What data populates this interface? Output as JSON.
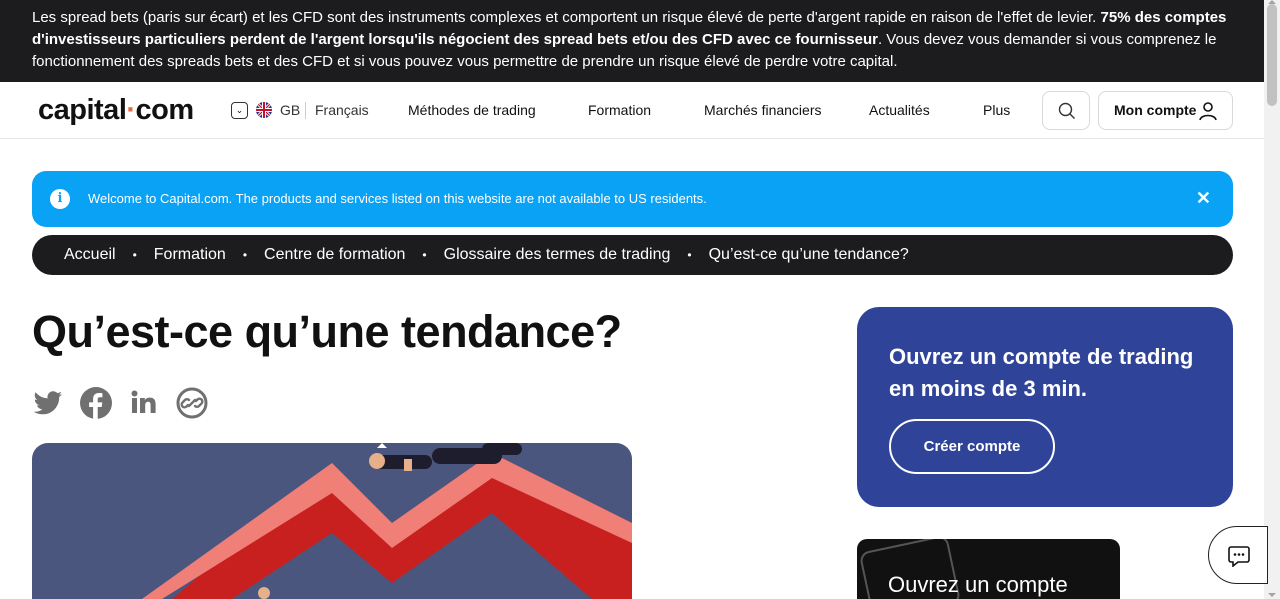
{
  "risk_banner": {
    "text_start": "Les spread bets (paris sur écart) et les CFD sont des instruments complexes et comportent un risque élevé de perte d'argent rapide en raison de l'effet de levier. ",
    "text_bold": "75% des comptes d'investisseurs particuliers perdent de l'argent lorsqu'ils négocient des spread bets et/ou des CFD avec ce fournisseur",
    "text_end": ". Vous devez vous demander si vous comprenez le fonctionnement des spreads bets et des CFD et si vous pouvez vous permettre de prendre un risque élevé de perdre votre capital."
  },
  "header": {
    "logo_left": "capital",
    "logo_dot": "·",
    "logo_right": "com",
    "region_code": "GB",
    "language": "Français",
    "nav": [
      "Méthodes de trading",
      "Formation",
      "Marchés financiers",
      "Actualités",
      "Plus"
    ],
    "account_label": "Mon compte"
  },
  "info_banner": {
    "icon": "i",
    "message": "Welcome to Capital.com. The products and services listed on this website are not available to US residents.",
    "close": "✕"
  },
  "breadcrumb": [
    "Accueil",
    "Formation",
    "Centre de formation",
    "Glossaire des termes de trading",
    "Qu’est-ce qu’une tendance?"
  ],
  "breadcrumb_sep": "•",
  "article": {
    "title": "Qu’est-ce qu’une tendance?"
  },
  "sidebar": {
    "cta_title": "Ouvrez un compte de trading en moins de 3 min.",
    "cta_button": "Créer compte",
    "promo_text": "Ouvrez un compte"
  },
  "icons": {
    "share": [
      "twitter-icon",
      "facebook-icon",
      "linkedin-icon",
      "copy-link-icon"
    ],
    "search": "search-icon",
    "user": "user-icon",
    "chat": "chat-icon"
  },
  "colors": {
    "brand_accent": "#e8663d",
    "info_blue": "#0aa2f5",
    "cta_blue": "#2f4499",
    "dark": "#1c1c1e"
  }
}
